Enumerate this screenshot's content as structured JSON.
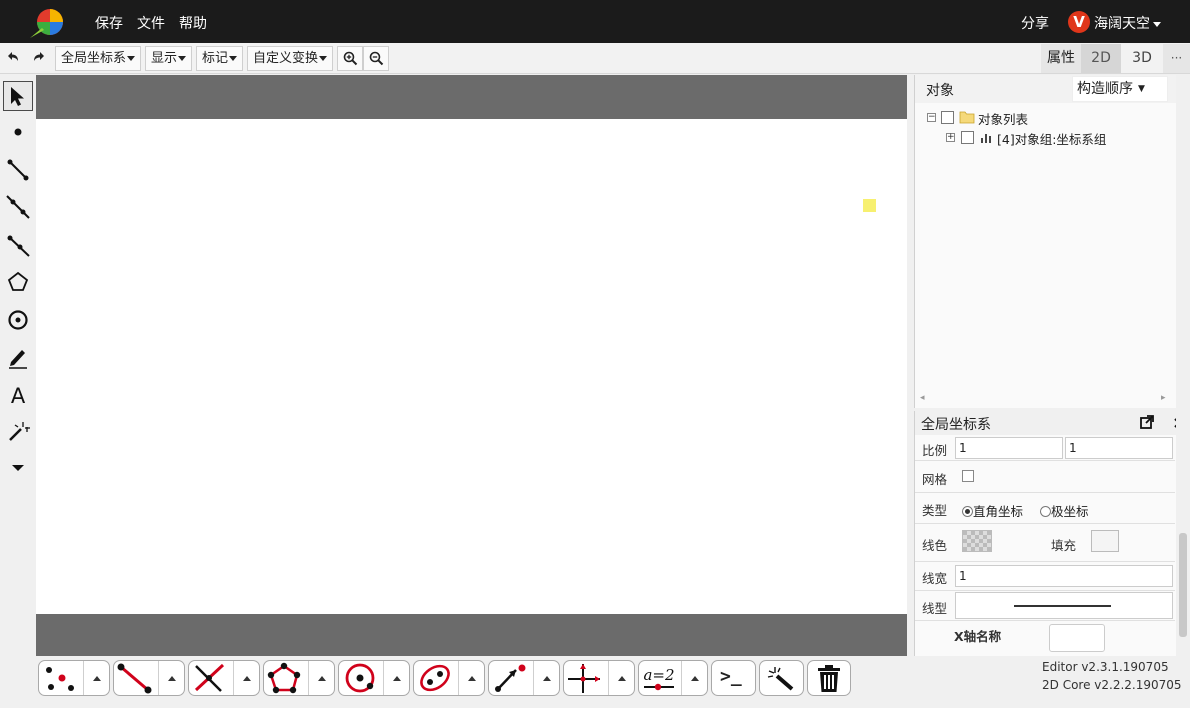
{
  "header": {
    "menu": [
      "保存",
      "文件",
      "帮助"
    ],
    "share": "分享",
    "user_initial": "V",
    "user_name": "海阔天空"
  },
  "toolbar": {
    "coord_system": "全局坐标系",
    "display": "显示",
    "mark": "标记",
    "custom_transform": "自定义变换",
    "tabs": [
      "属性",
      "2D",
      "3D"
    ],
    "more": "···"
  },
  "objects": {
    "title": "对象",
    "order": "构造顺序",
    "tree_root": "对象列表",
    "tree_child": "[4]对象组:坐标系组"
  },
  "properties": {
    "title": "全局坐标系",
    "scale_label": "比例",
    "scale_x": "1",
    "scale_y": "1",
    "grid_label": "网格",
    "type_label": "类型",
    "type_rect": "直角坐标",
    "type_polar": "极坐标",
    "line_color_label": "线色",
    "fill_label": "填充",
    "line_width_label": "线宽",
    "line_width": "1",
    "line_style_label": "线型",
    "x_axis_name_label": "X轴名称"
  },
  "bottom_tools": [
    "point",
    "segment",
    "intersection",
    "polygon",
    "circle",
    "conic",
    "vector",
    "parameter",
    "command",
    "magic",
    "delete"
  ],
  "parameter_label": "a=2",
  "command_label": ">_",
  "version": {
    "editor": "Editor v2.3.1.190705",
    "core": "2D Core v2.2.2.190705"
  }
}
